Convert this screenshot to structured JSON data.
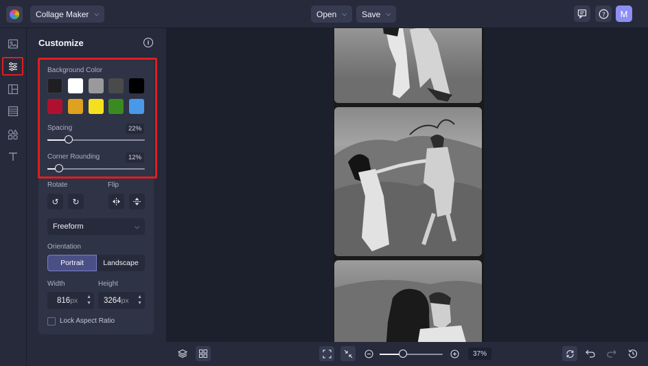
{
  "topbar": {
    "app_menu_label": "Collage Maker",
    "open_label": "Open",
    "save_label": "Save",
    "avatar_initial": "M"
  },
  "rail": {
    "items": [
      "images-icon",
      "customize-icon",
      "layouts-icon",
      "textures-icon",
      "graphics-icon",
      "text-icon"
    ],
    "active": "customize-icon"
  },
  "panel": {
    "title": "Customize",
    "background_color_label": "Background Color",
    "swatches_row1": [
      "#1f1f22",
      "#ffffff",
      "#9a9a9a",
      "#4a4a4a",
      "#000000"
    ],
    "swatches_row2": [
      "#b01030",
      "#e0a020",
      "#f5e020",
      "#3a8a20",
      "#4a98e8"
    ],
    "spacing_label": "Spacing",
    "spacing_value": "22%",
    "spacing_fraction": 0.22,
    "corner_label": "Corner Rounding",
    "corner_value": "12%",
    "corner_fraction": 0.12,
    "rotate_label": "Rotate",
    "flip_label": "Flip",
    "shape_select": "Freeform",
    "orientation_label": "Orientation",
    "portrait_label": "Portrait",
    "landscape_label": "Landscape",
    "width_label": "Width",
    "height_label": "Height",
    "width_value": "816",
    "height_value": "3264",
    "unit": "px",
    "lock_label": "Lock Aspect Ratio"
  },
  "bottombar": {
    "zoom_value": "37%",
    "zoom_fraction": 0.37
  },
  "colors": {
    "accent": "#4a4f86",
    "highlight": "#e01e1e",
    "avatar": "#8d8ff2"
  }
}
